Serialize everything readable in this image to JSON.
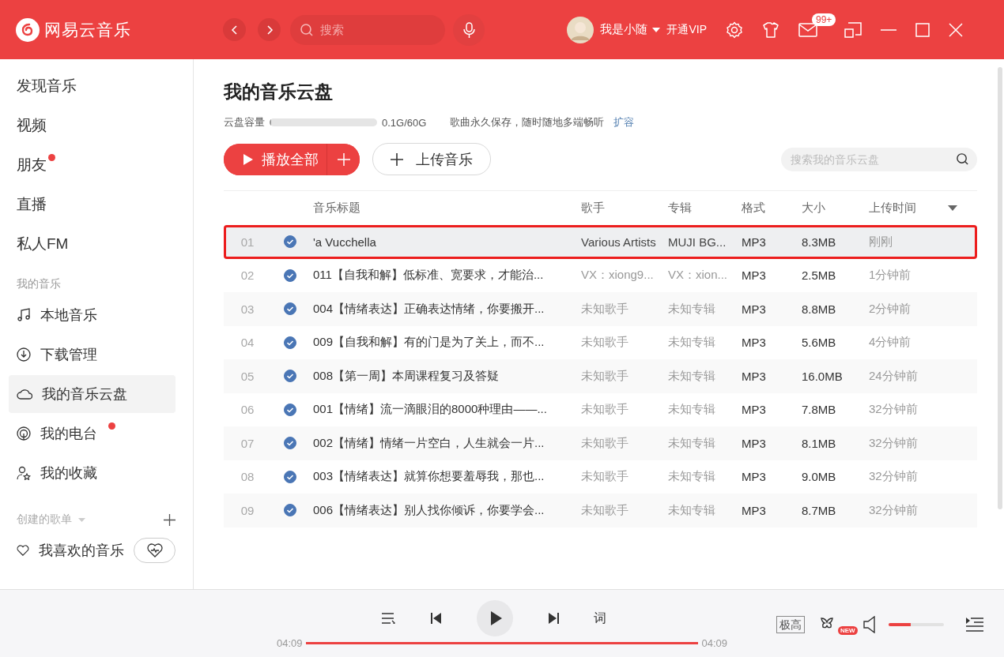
{
  "app": {
    "name": "网易云音乐"
  },
  "topbar": {
    "search": {
      "placeholder": "搜索"
    },
    "user": "我是小随",
    "vip": "开通VIP",
    "mail_badge": "99+"
  },
  "sidebar": {
    "items": [
      {
        "label": "发现音乐",
        "dot": false,
        "selected": false
      },
      {
        "label": "视频",
        "dot": false,
        "selected": false
      },
      {
        "label": "朋友",
        "dot": true,
        "selected": false
      },
      {
        "label": "直播",
        "dot": false,
        "selected": false
      },
      {
        "label": "私人FM",
        "dot": false,
        "selected": false
      }
    ],
    "my_music_heading": "我的音乐",
    "my_music": [
      {
        "label": "本地音乐",
        "dot": false,
        "selected": false
      },
      {
        "label": "下载管理",
        "dot": false,
        "selected": false
      },
      {
        "label": "我的音乐云盘",
        "dot": false,
        "selected": true
      },
      {
        "label": "我的电台",
        "dot": true,
        "selected": false
      },
      {
        "label": "我的收藏",
        "dot": false,
        "selected": false
      }
    ],
    "playlists_heading": "创建的歌单",
    "playlists": [
      {
        "label": "我喜欢的音乐",
        "selected": false
      }
    ]
  },
  "page": {
    "title": "我的音乐云盘",
    "capacity_label": "云盘容量",
    "capacity": {
      "level": 0.002
    },
    "capacity_text": "0.1G/60G",
    "slogan": "歌曲永久保存，随时随地多端畅听",
    "expand_link": "扩容",
    "play_all": "播放全部",
    "upload": "上传音乐",
    "search": {
      "placeholder": "搜索我的音乐云盘"
    }
  },
  "table": {
    "columns": [
      "音乐标题",
      "歌手",
      "专辑",
      "格式",
      "大小",
      "上传时间"
    ],
    "rows": [
      {
        "index": "01",
        "title": "'a Vucchella",
        "artist": "Various Artists",
        "album": "MUJI BG...",
        "format": "MP3",
        "size": "8.3MB",
        "time": "刚刚",
        "checked": true,
        "selected": true
      },
      {
        "index": "02",
        "title": "011【自我和解】低标准、宽要求，才能治...",
        "artist": "VX：xiong9...",
        "album": "VX：xion...",
        "format": "MP3",
        "size": "2.5MB",
        "time": "1分钟前",
        "checked": true,
        "selected": false
      },
      {
        "index": "03",
        "title": "004【情绪表达】正确表达情绪，你要搬开...",
        "artist": "未知歌手",
        "album": "未知专辑",
        "format": "MP3",
        "size": "8.8MB",
        "time": "2分钟前",
        "checked": true,
        "selected": false
      },
      {
        "index": "04",
        "title": "009【自我和解】有的门是为了关上，而不...",
        "artist": "未知歌手",
        "album": "未知专辑",
        "format": "MP3",
        "size": "5.6MB",
        "time": "4分钟前",
        "checked": true,
        "selected": false
      },
      {
        "index": "05",
        "title": "008【第一周】本周课程复习及答疑",
        "artist": "未知歌手",
        "album": "未知专辑",
        "format": "MP3",
        "size": "16.0MB",
        "time": "24分钟前",
        "checked": true,
        "selected": false
      },
      {
        "index": "06",
        "title": "001【情绪】流一滴眼泪的8000种理由——...",
        "artist": "未知歌手",
        "album": "未知专辑",
        "format": "MP3",
        "size": "7.8MB",
        "time": "32分钟前",
        "checked": true,
        "selected": false
      },
      {
        "index": "07",
        "title": "002【情绪】情绪一片空白，人生就会一片...",
        "artist": "未知歌手",
        "album": "未知专辑",
        "format": "MP3",
        "size": "8.1MB",
        "time": "32分钟前",
        "checked": true,
        "selected": false
      },
      {
        "index": "08",
        "title": "003【情绪表达】就算你想要羞辱我，那也...",
        "artist": "未知歌手",
        "album": "未知专辑",
        "format": "MP3",
        "size": "9.0MB",
        "time": "32分钟前",
        "checked": true,
        "selected": false
      },
      {
        "index": "09",
        "title": "006【情绪表达】别人找你倾诉，你要学会...",
        "artist": "未知歌手",
        "album": "未知专辑",
        "format": "MP3",
        "size": "8.7MB",
        "time": "32分钟前",
        "checked": true,
        "selected": false
      }
    ]
  },
  "player": {
    "lyrics": "词",
    "elapsed": "04:09",
    "progress": {
      "level": 1
    },
    "total": "04:09",
    "quality": "极高",
    "new_badge": "NEW",
    "volume": {
      "level": 0.4
    }
  }
}
